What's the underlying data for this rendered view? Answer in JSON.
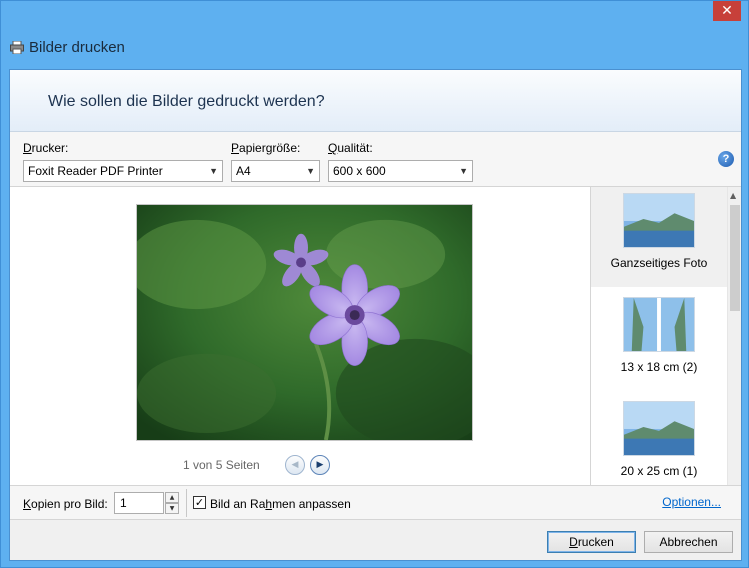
{
  "window": {
    "title": "Bilder drucken",
    "close_icon": "close-icon"
  },
  "header": {
    "heading": "Wie sollen die Bilder gedruckt werden?"
  },
  "options": {
    "printer_label_prefix": "D",
    "printer_label_rest": "rucker:",
    "printer_value": "Foxit Reader PDF Printer",
    "paper_label_prefix": "P",
    "paper_label_rest": "apiergröße:",
    "paper_value": "A4",
    "quality_label_prefix": "Q",
    "quality_label_rest": "ualität:",
    "quality_value": "600 x 600",
    "help_icon": "help-icon"
  },
  "preview": {
    "page_info": "1 von 5 Seiten",
    "prev_icon": "chevron-left-icon",
    "next_icon": "chevron-right-icon"
  },
  "layouts": {
    "items": [
      {
        "caption": "Ganzseitiges Foto",
        "selected": true
      },
      {
        "caption": "13 x 18 cm (2)",
        "selected": false
      },
      {
        "caption": "20 x 25 cm (1)",
        "selected": false
      }
    ]
  },
  "bottom": {
    "copies_label_prefix": "K",
    "copies_label_rest": "opien pro Bild:",
    "copies_value": "1",
    "fit_label_part1": "Bild an Ra",
    "fit_label_underlined": "h",
    "fit_label_part2": "men anpassen",
    "fit_checked": true,
    "options_link": "Optionen..."
  },
  "footer": {
    "print_prefix": "D",
    "print_rest": "rucken",
    "cancel_label": "Abbrechen"
  },
  "colors": {
    "title_bar": "#5eb0f0",
    "close_button": "#c7403a",
    "link": "#0066cc"
  }
}
